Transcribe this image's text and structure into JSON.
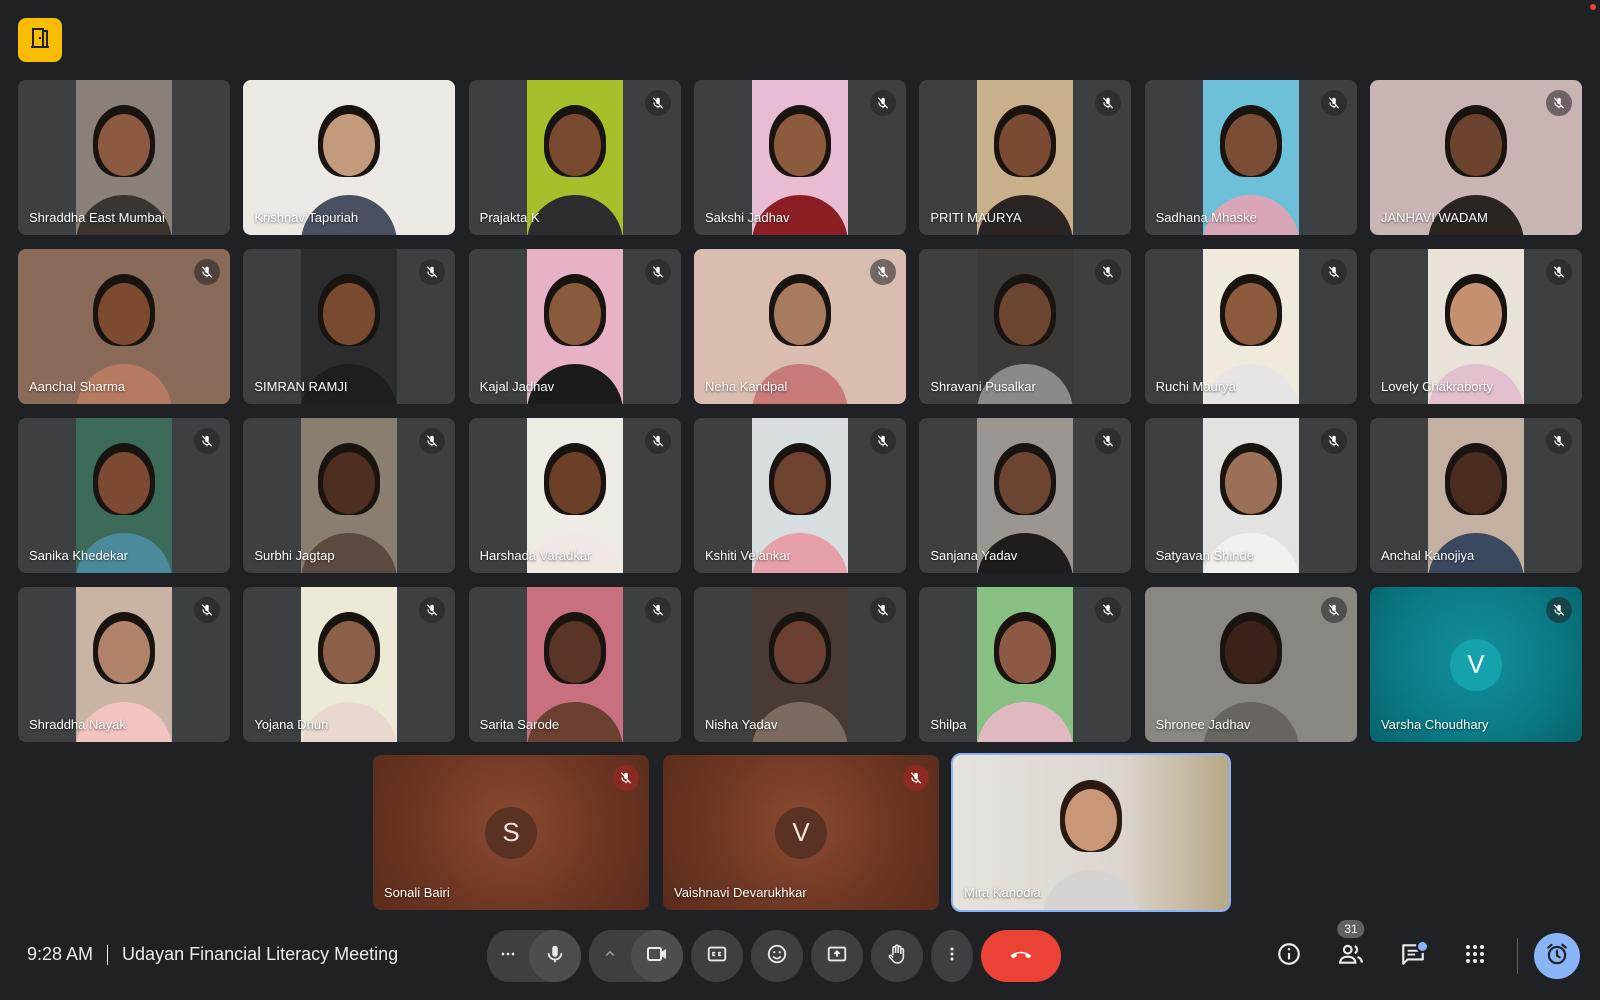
{
  "meeting": {
    "time": "9:28 AM",
    "title": "Udayan Financial Literacy Meeting",
    "participant_count": "31"
  },
  "grid_participants": [
    {
      "name": "Shraddha East Mumbai",
      "muted": false,
      "bg": "#8a8079",
      "skin": "#8b5a40",
      "shirt": "#3a3530"
    },
    {
      "name": "Krishnav Tapuriah",
      "muted": false,
      "bg": "#ece8e4",
      "skin": "#c49a7c",
      "shirt": "#4a5060",
      "full": true
    },
    {
      "name": "Prajakta K",
      "muted": true,
      "bg": "#a6c02c",
      "skin": "#7a4a30",
      "shirt": "#2d2d30"
    },
    {
      "name": "Sakshi Jadhav",
      "muted": true,
      "bg": "#e8bcd3",
      "skin": "#8c5a3c",
      "shirt": "#8c1f24"
    },
    {
      "name": "PRITI MAURYA",
      "muted": true,
      "bg": "#c9b08a",
      "skin": "#7a4b32",
      "shirt": "#2a2523"
    },
    {
      "name": "Sadhana Mhaske",
      "muted": true,
      "bg": "#6ec0d8",
      "skin": "#7c4d35",
      "shirt": "#d9a6b8"
    },
    {
      "name": "JANHAVI WADAM",
      "muted": true,
      "bg": "#c9b4b4",
      "skin": "#6c432f",
      "shirt": "#2a2520",
      "full": true
    },
    {
      "name": "Aanchal Sharma",
      "muted": true,
      "bg": "#8a6a58",
      "skin": "#7c4a2e",
      "shirt": "#b67a60",
      "full": true
    },
    {
      "name": "SIMRAN RAMJI",
      "muted": true,
      "bg": "#2a2c2e",
      "skin": "#7a4a30",
      "shirt": "#1e1e20"
    },
    {
      "name": "Kajal Jadhav",
      "muted": true,
      "bg": "#e7b1c7",
      "skin": "#8a5a3c",
      "shirt": "#1b1b1d"
    },
    {
      "name": "Neha Kandpal",
      "muted": true,
      "bg": "#d8bdb0",
      "skin": "#a87a60",
      "shirt": "#c87a78",
      "full": true
    },
    {
      "name": "Shravani Pusalkar",
      "muted": true,
      "bg": "#3b3a36",
      "skin": "#6c4530",
      "shirt": "#8a8a88"
    },
    {
      "name": "Ruchi Maurya",
      "muted": true,
      "bg": "#efeadb",
      "skin": "#8c5a3c",
      "shirt": "#e8e4e6"
    },
    {
      "name": "Lovely Chakraborty",
      "muted": true,
      "bg": "#e8e2d8",
      "skin": "#c49070",
      "shirt": "#e3c0d0"
    },
    {
      "name": "Sanika Khedekar",
      "muted": true,
      "bg": "#3c6b5a",
      "skin": "#7c4a32",
      "shirt": "#4a8a9a"
    },
    {
      "name": "Surbhi Jagtap",
      "muted": true,
      "bg": "#8a7e70",
      "skin": "#4e2e20",
      "shirt": "#5a4a40"
    },
    {
      "name": "Harshada Varadkar",
      "muted": true,
      "bg": "#eeeae4",
      "skin": "#6c4028",
      "shirt": "#f0e8e4"
    },
    {
      "name": "Kshiti Velankar",
      "muted": true,
      "bg": "#d8dde0",
      "skin": "#6e4330",
      "shirt": "#e8a0a8"
    },
    {
      "name": "Sanjana Yadav",
      "muted": true,
      "bg": "#9a9590",
      "skin": "#6c4532",
      "shirt": "#1e1c1c"
    },
    {
      "name": "Satyavan Shinde",
      "muted": true,
      "bg": "#e2e2e0",
      "skin": "#9c7058",
      "shirt": "#f2f0ee"
    },
    {
      "name": "Anchal Kanojiya",
      "muted": true,
      "bg": "#c4b0a0",
      "skin": "#4a2c20",
      "shirt": "#3a4860"
    },
    {
      "name": "Shraddha Nayak",
      "muted": true,
      "bg": "#c9b4a4",
      "skin": "#b0826a",
      "shirt": "#f2c4c0"
    },
    {
      "name": "Yojana Dhuri",
      "muted": true,
      "bg": "#ecead6",
      "skin": "#8c6048",
      "shirt": "#e8d8d0"
    },
    {
      "name": "Sarita Sarode",
      "muted": true,
      "bg": "#c87080",
      "skin": "#5a3424",
      "shirt": "#6a4030"
    },
    {
      "name": "Nisha Yadav",
      "muted": true,
      "bg": "#4a3a34",
      "skin": "#6a4030",
      "shirt": "#7a6a60"
    },
    {
      "name": "Shilpa",
      "muted": true,
      "bg": "#88c084",
      "skin": "#8c5a44",
      "shirt": "#e0b8c0"
    },
    {
      "name": "Shronee Jadhav",
      "muted": true,
      "bg": "#8a8682",
      "skin": "#3a2218",
      "shirt": "#6a6460",
      "full": true
    }
  ],
  "avatar_participants": [
    {
      "name": "Varsha Choudhary",
      "initial": "V",
      "muted": true
    }
  ],
  "bottom_participants": [
    {
      "name": "Sonali Bairi",
      "initial": "S",
      "muted": true
    },
    {
      "name": "Vaishnavi Devarukhkar",
      "initial": "V",
      "muted": true
    }
  ],
  "self_participant": {
    "name": "Mira Kanodia",
    "muted": false
  },
  "colors": {
    "background": "#202124",
    "tile": "#3c4043",
    "teal_tile": "#0b7c86",
    "brown_tile": "#6b3522",
    "accent_blue": "#8ab4f8",
    "end_call_red": "#ea4335",
    "badge_yellow": "#fbbc04"
  },
  "icons": {
    "top_badge": "door-icon",
    "more": "more-horizontal-icon",
    "mic": "microphone-icon",
    "expand": "chevron-up-icon",
    "camera": "camera-icon",
    "captions": "captions-icon",
    "emoji": "emoji-icon",
    "present": "present-screen-icon",
    "hand": "raise-hand-icon",
    "overflow": "more-vertical-icon",
    "end_call": "end-call-icon",
    "info": "info-icon",
    "people": "people-icon",
    "chat": "chat-icon",
    "activities": "apps-grid-icon",
    "timer": "timer-icon"
  }
}
